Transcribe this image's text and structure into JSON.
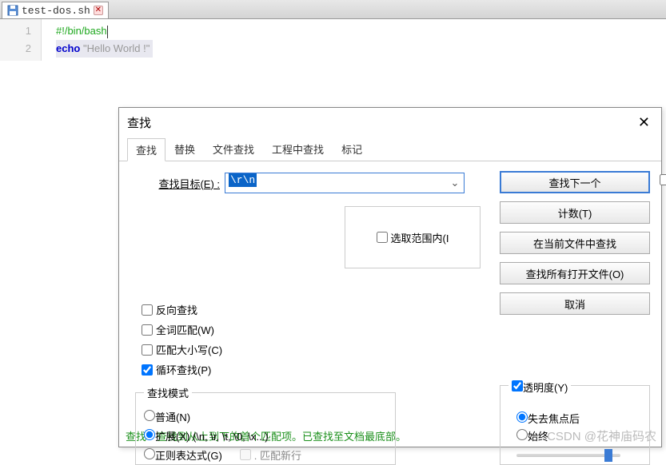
{
  "file_tab": {
    "name": "test-dos.sh"
  },
  "editor": {
    "lines": [
      "1",
      "2"
    ],
    "line1_comment": "#!/bin/bash",
    "line2_kw": "echo",
    "line2_str": " \"Hello World !\""
  },
  "dialog": {
    "title": "查找",
    "tabs": {
      "find": "查找",
      "replace": "替换",
      "file_find": "文件查找",
      "proj_find": "工程中查找",
      "mark": "标记"
    },
    "search_label": "查找目标(E) :",
    "search_value": "\\r\\n",
    "buttons": {
      "find_next": "查找下一个",
      "count": "计数(T)",
      "find_in_current": "在当前文件中查找",
      "find_all_open": "查找所有打开文件(O)",
      "cancel": "取消"
    },
    "middle": {
      "select_range": "选取范围内(I"
    },
    "opts": {
      "reverse": "反向查找",
      "whole_word": "全词匹配(W)",
      "match_case": "匹配大小写(C)",
      "loop": "循环查找(P)"
    },
    "mode": {
      "legend": "查找模式",
      "normal": "普通(N)",
      "extended": "扩展(X) (\\n, \\r, \\t, \\0, \\x...)",
      "regex": "正则表达式(G)",
      "match_newline": ". 匹配新行"
    },
    "trans": {
      "check": "透明度(Y)",
      "lose_focus": "失去焦点后",
      "always": "始终"
    },
    "status": "查找：查找到从上到下的首个匹配项。已查找至文档最底部。"
  },
  "watermark": "CSDN @花神庙码农"
}
